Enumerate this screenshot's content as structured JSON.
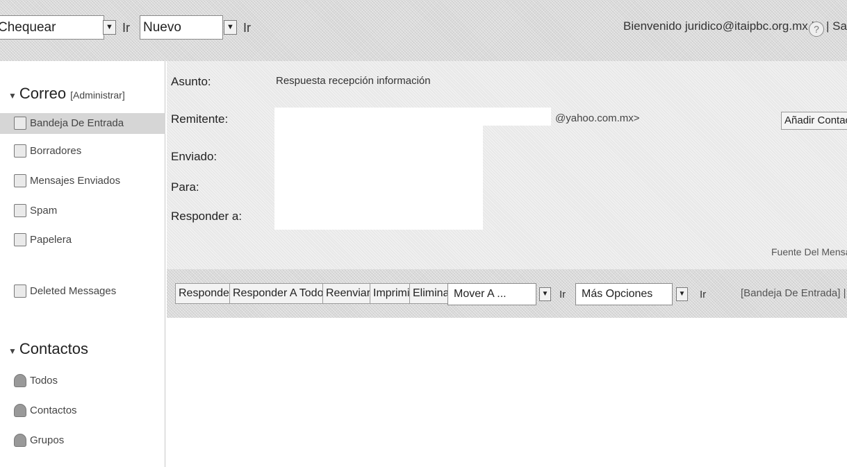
{
  "topbar": {
    "check_select": "Chequear",
    "check_go": "Ir",
    "new_select": "Nuevo",
    "new_go": "Ir",
    "welcome": "Bienvenido juridico@itaipbc.org.mx |",
    "help_icon": "?",
    "logout": "| Sali"
  },
  "sidebar": {
    "mail": {
      "title": "Correo",
      "manage": "[Administrar]",
      "items": [
        {
          "label": "Bandeja De Entrada",
          "icon": "inbox-icon"
        },
        {
          "label": "Borradores",
          "icon": "drafts-icon"
        },
        {
          "label": "Mensajes Enviados",
          "icon": "sent-icon"
        },
        {
          "label": "Spam",
          "icon": "spam-icon"
        },
        {
          "label": "Papelera",
          "icon": "trash-icon"
        },
        {
          "label": "Deleted Messages",
          "icon": "folder-icon"
        }
      ]
    },
    "contacts": {
      "title": "Contactos",
      "items": [
        {
          "label": "Todos",
          "icon": "person-icon"
        },
        {
          "label": "Contactos",
          "icon": "person-icon"
        },
        {
          "label": "Grupos",
          "icon": "group-icon"
        }
      ]
    }
  },
  "message": {
    "subject_label": "Asunto:",
    "subject": "Respuesta recepción información",
    "from_label": "Remitente:",
    "from_suffix": "@yahoo.com.mx>",
    "sent_label": "Enviado:",
    "to_label": "Para:",
    "reply_to_label": "Responder a:",
    "add_contact": "Añadir Contact",
    "source": "Fuente Del Mensa"
  },
  "toolbar": {
    "reply": "Responder",
    "reply_all": "Responder A Todos",
    "forward": "Reenviar",
    "print": "Imprimir",
    "delete": "Eliminar",
    "move_select": "Mover A ...",
    "move_go": "Ir",
    "more_select": "Más Opciones",
    "more_go": "Ir",
    "folder_link": "[Bandeja De Entrada] | «"
  },
  "colors": {
    "background": "#ffffff",
    "panel": "#d9d9d9",
    "active_item": "#d6d6d6"
  }
}
